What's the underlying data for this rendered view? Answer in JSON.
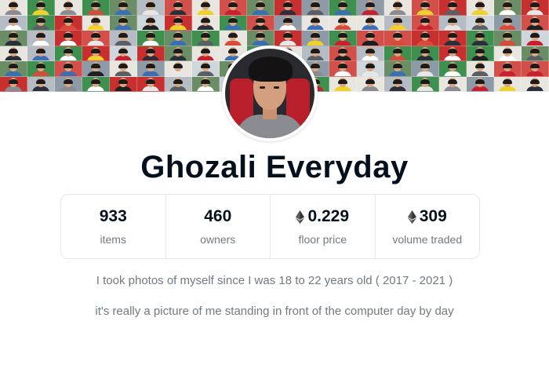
{
  "collection": {
    "name": "Ghozali Everyday",
    "stats": [
      {
        "value": "933",
        "label": "items",
        "eth": false
      },
      {
        "value": "460",
        "label": "owners",
        "eth": false
      },
      {
        "value": "0.229",
        "label": "floor price",
        "eth": true
      },
      {
        "value": "309",
        "label": "volume traded",
        "eth": true
      }
    ],
    "description": [
      "I took photos of myself since I was 18 to 22 years old ( 2017 - 2021 )",
      "it's really a picture of me standing in front of the computer day by day"
    ]
  },
  "banner": {
    "icon": "photo-mosaic",
    "shirt_colors": [
      "#2b2f3a",
      "#c8202e",
      "#f0d12a",
      "#ffffff",
      "#3a6fb5",
      "#8a8c91",
      "#1f1f22",
      "#e7e7e7",
      "#d84a3c",
      "#5a5f66"
    ],
    "background_colors": [
      "#3f8f4f",
      "#c7302f",
      "#b6bcc4",
      "#e9e6e0",
      "#6a8d66",
      "#d24f4a",
      "#cfd6dc",
      "#8e9aa6"
    ]
  },
  "avatar": {
    "icon": "profile-photo"
  },
  "icons": {
    "eth": "ethereum-icon"
  },
  "colors": {
    "text": "#04111d",
    "muted": "#707a83",
    "border": "#e5e8eb"
  }
}
